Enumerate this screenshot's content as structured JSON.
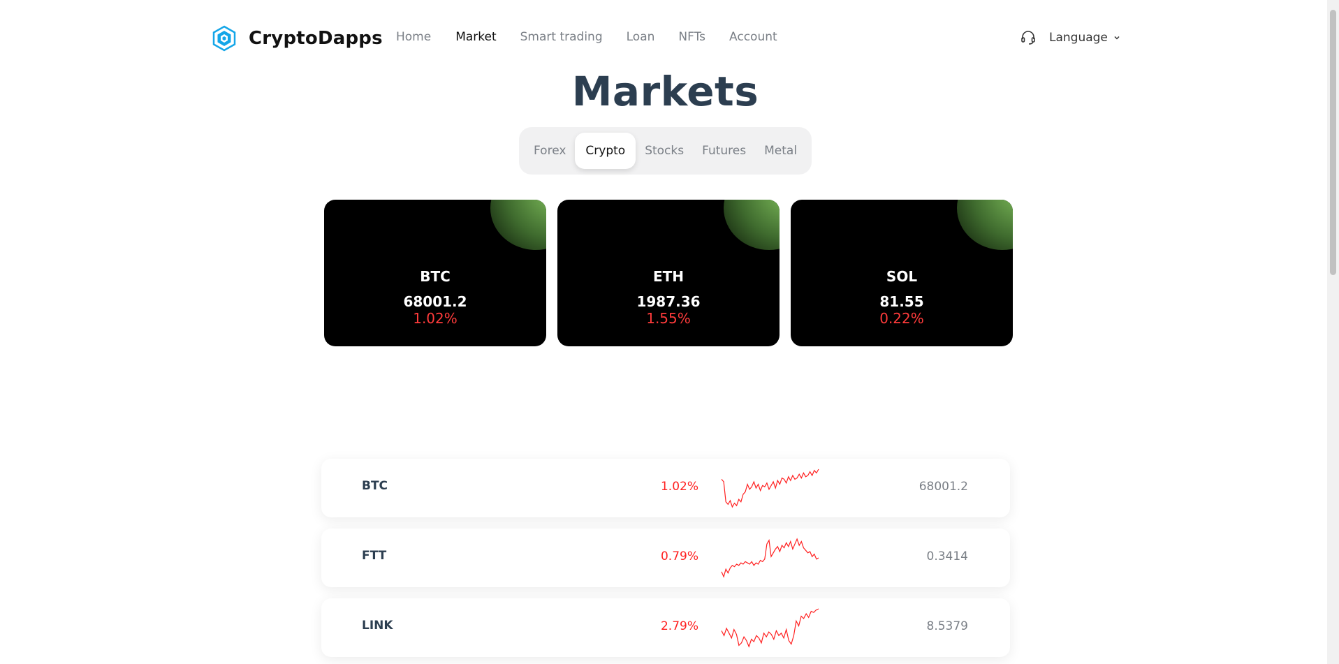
{
  "brand": {
    "name": "CryptoDapps",
    "icon": "hexagon-logo-icon",
    "color": "#14a6e8"
  },
  "nav": {
    "items": [
      {
        "label": "Home",
        "active": false
      },
      {
        "label": "Market",
        "active": true
      },
      {
        "label": "Smart trading",
        "active": false
      },
      {
        "label": "Loan",
        "active": false
      },
      {
        "label": "NFTs",
        "active": false
      },
      {
        "label": "Account",
        "active": false
      }
    ]
  },
  "utility": {
    "support_icon": "headset-icon",
    "language_label": "Language"
  },
  "page": {
    "title": "Markets"
  },
  "tabs": [
    {
      "label": "Forex",
      "active": false
    },
    {
      "label": "Crypto",
      "active": true
    },
    {
      "label": "Stocks",
      "active": false
    },
    {
      "label": "Futures",
      "active": false
    },
    {
      "label": "Metal",
      "active": false
    }
  ],
  "cards": [
    {
      "symbol": "BTC",
      "price": "68001.2",
      "change": "1.02%"
    },
    {
      "symbol": "ETH",
      "price": "1987.36",
      "change": "1.55%"
    },
    {
      "symbol": "SOL",
      "price": "81.55",
      "change": "0.22%"
    }
  ],
  "rows": [
    {
      "symbol": "BTC",
      "change": "1.02%",
      "price": "68001.2",
      "spark": [
        10,
        12,
        28,
        30,
        27,
        32,
        29,
        31,
        26,
        28,
        22,
        20,
        14,
        18,
        16,
        12,
        17,
        14,
        19,
        15,
        16,
        13,
        18,
        15,
        12,
        17,
        11,
        14,
        9,
        10,
        13,
        8,
        11,
        7,
        10,
        9,
        6,
        9,
        5,
        8,
        7,
        4,
        7,
        3,
        5,
        2
      ]
    },
    {
      "symbol": "FTT",
      "change": "0.79%",
      "price": "0.3414",
      "spark": [
        30,
        34,
        28,
        31,
        27,
        25,
        26,
        24,
        25,
        23,
        24,
        22,
        23,
        24,
        22,
        25,
        23,
        24,
        21,
        22,
        20,
        8,
        5,
        18,
        15,
        12,
        10,
        14,
        9,
        11,
        7,
        10,
        6,
        12,
        8,
        4,
        9,
        6,
        11,
        13,
        15,
        14,
        18,
        16,
        20,
        19
      ]
    },
    {
      "symbol": "LINK",
      "change": "2.79%",
      "price": "8.5379",
      "spark": [
        20,
        24,
        18,
        22,
        26,
        19,
        23,
        32,
        30,
        25,
        28,
        33,
        27,
        29,
        24,
        26,
        30,
        22,
        25,
        21,
        23,
        27,
        20,
        24,
        22,
        26,
        19,
        28,
        31,
        24,
        12,
        16,
        8,
        10,
        6,
        9,
        4,
        5,
        3,
        2
      ]
    }
  ],
  "colors": {
    "negative": "#ff1f1f",
    "card_bg": "#000000",
    "title": "#2c3e50",
    "accent_glow": "#7dbb5a"
  }
}
